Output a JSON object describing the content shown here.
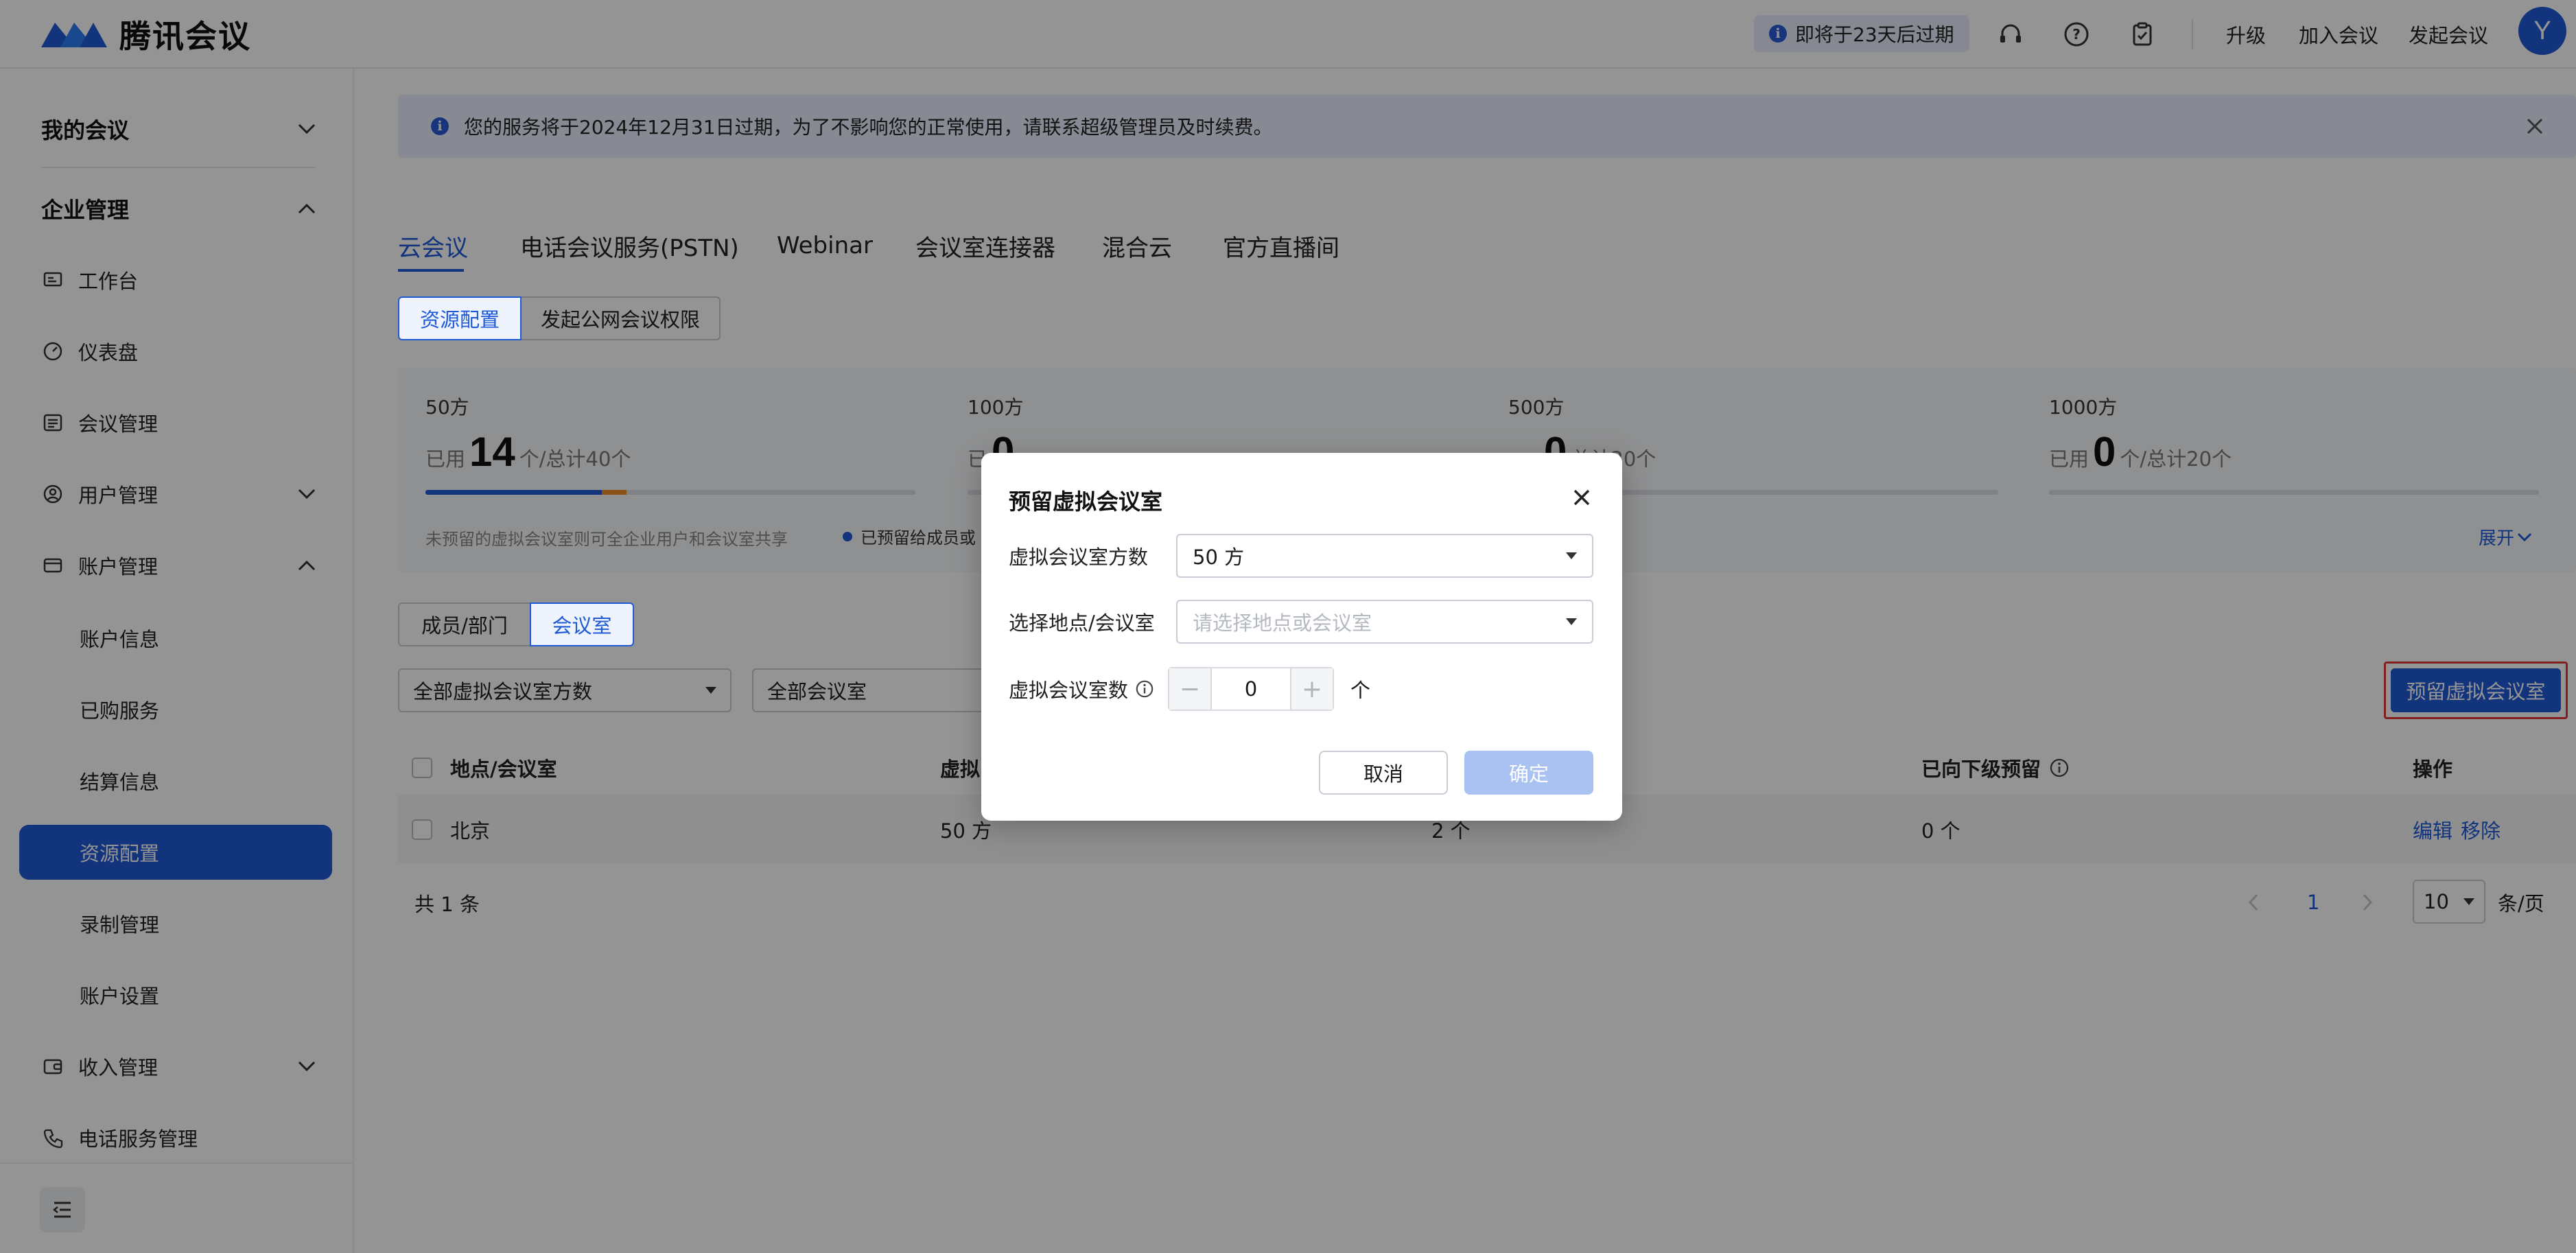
{
  "app": {
    "logo_text": "腾讯会议"
  },
  "topbar": {
    "expire_badge": "即将于23天后过期",
    "links": [
      "升级",
      "加入会议",
      "发起会议"
    ],
    "avatar_initial": "Y"
  },
  "sidebar": {
    "my_meetings": "我的会议",
    "enterprise": "企业管理",
    "items": [
      {
        "label": "工作台",
        "icon": "workbench-icon"
      },
      {
        "label": "仪表盘",
        "icon": "dashboard-icon"
      },
      {
        "label": "会议管理",
        "icon": "meeting-list-icon"
      },
      {
        "label": "用户管理",
        "icon": "user-icon"
      },
      {
        "label": "账户管理",
        "icon": "account-card-icon"
      }
    ],
    "account_sub": [
      "账户信息",
      "已购服务",
      "结算信息",
      "资源配置",
      "录制管理",
      "账户设置"
    ],
    "income": "收入管理",
    "phone": "电话服务管理"
  },
  "notice": {
    "text": "您的服务将于2024年12月31日过期，为了不影响您的正常使用，请联系超级管理员及时续费。"
  },
  "tabs": [
    "云会议",
    "电话会议服务(PSTN)",
    "Webinar",
    "会议室连接器",
    "混合云",
    "官方直播间"
  ],
  "segment_top": [
    "资源配置",
    "发起公网会议权限"
  ],
  "quota": {
    "cards": [
      {
        "label": "50方",
        "used_prefix": "已用",
        "used": "14",
        "total": "个/总计40个",
        "used_pct": 0.36,
        "reserved_pct": 0.05
      },
      {
        "label": "100方",
        "used_prefix": "已",
        "used": "0",
        "total": "",
        "used_pct": 0,
        "reserved_pct": 0
      },
      {
        "label": "500方",
        "used_prefix": "",
        "used": "0",
        "total": "总计20个",
        "used_pct": 0,
        "reserved_pct": 0
      },
      {
        "label": "1000方",
        "used_prefix": "已用",
        "used": "0",
        "total": "个/总计20个",
        "used_pct": 0,
        "reserved_pct": 0
      }
    ],
    "note": "未预留的虚拟会议室则可全企业用户和会议室共享",
    "legend": "已预留给成员或",
    "expand": "展开"
  },
  "segment_mid": [
    "成员/部门",
    "会议室"
  ],
  "filters": {
    "capacity": "全部虚拟会议室方数",
    "room": "全部会议室"
  },
  "reserve_button": "预留虚拟会议室",
  "table": {
    "headers": [
      "地点/会议室",
      "虚拟",
      "已向下级预留",
      "操作"
    ],
    "rows": [
      {
        "location": "北京",
        "capacity": "50 方",
        "count": "2 个",
        "sub_reserved": "0 个",
        "actions": [
          "编辑",
          "移除"
        ]
      }
    ]
  },
  "pagination": {
    "total": "共 1 条",
    "current": "1",
    "page_size": "10",
    "per_page": "条/页"
  },
  "modal": {
    "title": "预留虚拟会议室",
    "capacity_label": "虚拟会议室方数",
    "capacity_value": "50 方",
    "location_label": "选择地点/会议室",
    "location_placeholder": "请选择地点或会议室",
    "count_label": "虚拟会议室数",
    "count_value": "0",
    "count_unit": "个",
    "cancel": "取消",
    "confirm": "确定"
  },
  "colors": {
    "brand": "#1f5ad6",
    "highlight": "#e23a3a",
    "reserved": "#f08a24"
  }
}
